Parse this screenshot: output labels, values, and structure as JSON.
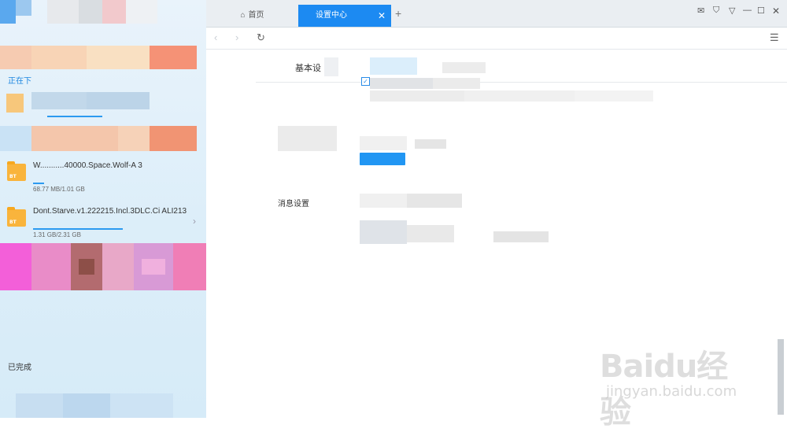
{
  "tabs": {
    "home_label": "首页",
    "settings_label": "设置中心",
    "close_glyph": "✕",
    "new_tab_glyph": "+"
  },
  "window_controls": {
    "mail": "✉",
    "skin": "⛉",
    "menu": "▽",
    "minimize": "—",
    "maximize": "☐",
    "close": "✕"
  },
  "nav": {
    "back": "‹",
    "forward": "›",
    "refresh": "↻",
    "menu": "☰"
  },
  "left_panel": {
    "downloading_label": "正在下",
    "done_label": "已完成",
    "bt_badge": "BT",
    "items": [
      {
        "name": "W...........40000.Space.Wolf-A 3",
        "size": "68.77 MB/1.01 GB",
        "progress": 0.07
      },
      {
        "name": "Dont.Starve.v1.222215.Incl.3DLC.Ci ALI213",
        "size": "1.31 GB/2.31 GB",
        "progress": 0.57
      }
    ]
  },
  "settings": {
    "tab_basic": "基本设",
    "tab_advanced": "",
    "message_settings_label": "消息设置",
    "check_mark": "✓"
  },
  "watermark": {
    "logo": "Baidu经验",
    "url": "jingyan.baidu.com"
  }
}
